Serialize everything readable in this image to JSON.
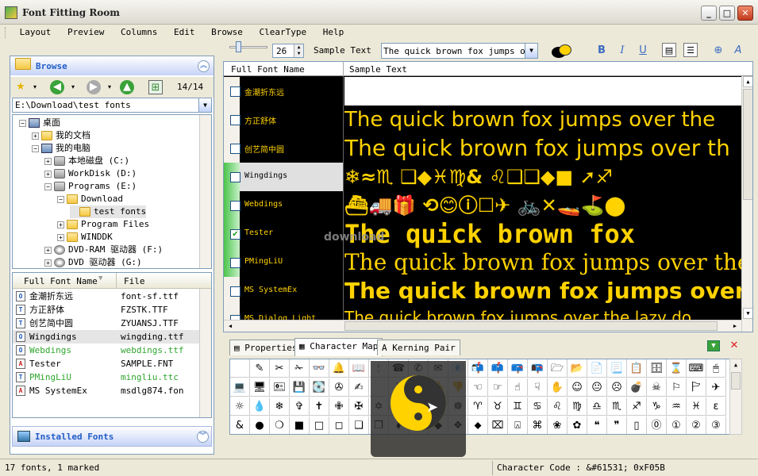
{
  "app": {
    "title": "Font Fitting Room"
  },
  "menu": [
    "Layout",
    "Preview",
    "Columns",
    "Edit",
    "Browse",
    "ClearType",
    "Help"
  ],
  "browse": {
    "title": "Browse",
    "counter": "14/14",
    "path": "E:\\Download\\test fonts",
    "installed_label": "Installed Fonts"
  },
  "tree": [
    {
      "label": "桌面",
      "indent": 0,
      "exp": "−",
      "icon": "desktop"
    },
    {
      "label": "我的文档",
      "indent": 1,
      "exp": "+",
      "icon": "folder"
    },
    {
      "label": "我的电脑",
      "indent": 1,
      "exp": "−",
      "icon": "computer"
    },
    {
      "label": "本地磁盘 (C:)",
      "indent": 2,
      "exp": "+",
      "icon": "drive"
    },
    {
      "label": "WorkDisk (D:)",
      "indent": 2,
      "exp": "+",
      "icon": "drive"
    },
    {
      "label": "Programs (E:)",
      "indent": 2,
      "exp": "−",
      "icon": "drive"
    },
    {
      "label": "Download",
      "indent": 3,
      "exp": "−",
      "icon": "folder"
    },
    {
      "label": "test fonts",
      "indent": 4,
      "exp": "",
      "icon": "folder",
      "selected": true
    },
    {
      "label": "Program Files",
      "indent": 3,
      "exp": "+",
      "icon": "folder"
    },
    {
      "label": "WINDDK",
      "indent": 3,
      "exp": "+",
      "icon": "folder"
    },
    {
      "label": "DVD-RAM 驱动器 (F:)",
      "indent": 2,
      "exp": "+",
      "icon": "disc"
    },
    {
      "label": "DVD 驱动器 (G:)",
      "indent": 2,
      "exp": "+",
      "icon": "disc"
    }
  ],
  "fontlist": {
    "col1": "Full Font Name",
    "col2": "File",
    "rows": [
      {
        "name": "金潮折东远",
        "file": "font-sf.ttf",
        "type": "O",
        "green": false,
        "selected": false
      },
      {
        "name": "方正舒体",
        "file": "FZSTK.TTF",
        "type": "T",
        "green": false,
        "selected": false
      },
      {
        "name": "创艺简中圆",
        "file": "ZYUANSJ.TTF",
        "type": "T",
        "green": false,
        "selected": false
      },
      {
        "name": "Wingdings",
        "file": "wingding.ttf",
        "type": "O",
        "green": false,
        "selected": true
      },
      {
        "name": "Webdings",
        "file": "webdings.ttf",
        "type": "O",
        "green": true,
        "selected": false
      },
      {
        "name": "Tester",
        "file": "SAMPLE.FNT",
        "type": "A",
        "green": false,
        "selected": false
      },
      {
        "name": "PMingLiU",
        "file": "mingliu.ttc",
        "type": "T",
        "green": true,
        "selected": false
      },
      {
        "name": "MS SystemEx",
        "file": "msdlg874.fon",
        "type": "A",
        "green": false,
        "selected": false
      }
    ]
  },
  "toolbar": {
    "size": "26",
    "sample_label": "Sample Text",
    "sample_value": "The quick brown fox jumps over"
  },
  "grid": {
    "col1": "Full Font Name",
    "col2": "Sample Text",
    "rows": [
      {
        "name": "金潮折东远",
        "sample": "",
        "checked": false,
        "marked": false,
        "selected": false,
        "size": 20,
        "family": "serif",
        "weight": "normal"
      },
      {
        "name": "方正舒体",
        "sample": "The quick brown fox jumps over the",
        "checked": false,
        "marked": false,
        "selected": false,
        "size": 26,
        "family": "sans-serif",
        "weight": "normal"
      },
      {
        "name": "创艺简中圆",
        "sample": "The quick brown fox jumps over th",
        "checked": false,
        "marked": false,
        "selected": false,
        "size": 28,
        "family": "sans-serif",
        "weight": "normal"
      },
      {
        "name": "Wingdings",
        "sample": "❄≈♏ ❑◆♓♍& ♌❑❑◆■ ➚♐",
        "checked": false,
        "marked": true,
        "selected": true,
        "size": 24,
        "family": "sans-serif",
        "weight": "bold"
      },
      {
        "name": "Webdings",
        "sample": "⛴🚚🎁 ⟲😊ⓘ☐✈ 🚲✕🚤⛳⬤",
        "checked": false,
        "marked": true,
        "selected": false,
        "size": 24,
        "family": "sans-serif",
        "weight": "bold"
      },
      {
        "name": "Tester",
        "sample": "The quick brown fox",
        "checked": true,
        "marked": true,
        "selected": false,
        "size": 32,
        "family": "monospace",
        "weight": "bold"
      },
      {
        "name": "PMingLiU",
        "sample": "The quick brown fox jumps over the l",
        "checked": false,
        "marked": true,
        "selected": false,
        "size": 28,
        "family": "serif",
        "weight": "normal"
      },
      {
        "name": "MS SystemEx",
        "sample": "The quick brown fox jumps over",
        "checked": false,
        "marked": false,
        "selected": false,
        "size": 28,
        "family": "sans-serif",
        "weight": "bold"
      },
      {
        "name": "MS Dialog Light",
        "sample": "The quick brown fox jumps over the lazy do",
        "checked": false,
        "marked": false,
        "selected": false,
        "size": 20,
        "family": "sans-serif",
        "weight": "normal"
      }
    ]
  },
  "tabs": [
    "Properties",
    "Character Map",
    "Kerning Pair"
  ],
  "charmap": [
    "",
    "✎",
    "✂",
    "✁",
    "👓",
    "🔔",
    "📖",
    "🕯",
    "☎",
    "✆",
    "✉",
    "📧",
    "📬",
    "📫",
    "📪",
    "📭",
    "🗁",
    "📂",
    "📄",
    "📃",
    "📋",
    "🗄",
    "⌛",
    "⌨",
    "🖱",
    "💻",
    "🖥",
    "🖭",
    "💾",
    "💽",
    "✇",
    "✍",
    "",
    "✌",
    "👌",
    "👍",
    "👎",
    "☜",
    "☞",
    "☝",
    "☟",
    "✋",
    "☺",
    "😐",
    "☹",
    "💣",
    "☠",
    "⚐",
    "🏱",
    "✈",
    "☼",
    "💧",
    "❄",
    "✞",
    "✝",
    "✙",
    "✠",
    "✡",
    "☪",
    "☯",
    "ॐ",
    "☸",
    "♈",
    "♉",
    "♊",
    "♋",
    "♌",
    "♍",
    "♎",
    "♏",
    "♐",
    "♑",
    "♒",
    "♓",
    "ε",
    "&",
    "●",
    "❍",
    "■",
    "□",
    "◻",
    "❑",
    "❒",
    "⬧",
    "⧫",
    "◆",
    "❖",
    "⬥",
    "⌧",
    "⍓",
    "⌘",
    "❀",
    "✿",
    "❝",
    "❞",
    "▯",
    "⓪",
    "①",
    "②",
    "③"
  ],
  "status": {
    "left": "17 fonts, 1 marked",
    "right": "Character Code : &#61531; 0xF05B"
  },
  "watermark": "download"
}
